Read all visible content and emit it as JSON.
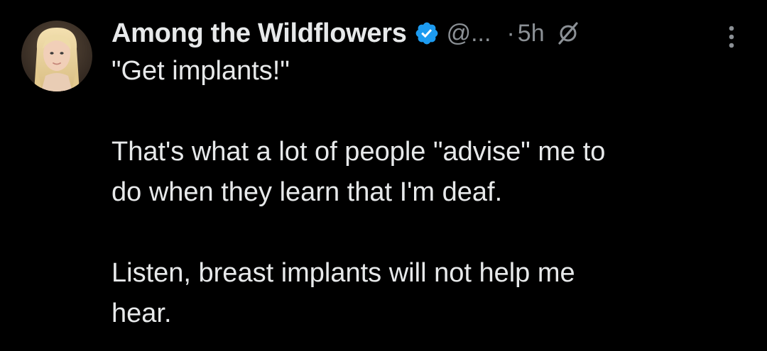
{
  "tweet": {
    "author": {
      "display_name": "Among the Wildflowers",
      "handle": "@...",
      "verified": true,
      "avatar_icon": "avatar-woman-blonde"
    },
    "dot_separator": "·",
    "time": "5h",
    "grok_icon": "grok-icon",
    "more_icon": "more-vertical-icon",
    "text": {
      "line1": "\"Get implants!\"",
      "line2a": "That's what a lot of people \"advise\" me to",
      "line2b": "do when they learn that I'm deaf.",
      "line3a": "Listen, breast implants will not help me",
      "line3b": "hear."
    },
    "colors": {
      "background": "#000000",
      "text": "#e7e9ea",
      "secondary": "#8b9095",
      "verified": "#1d9bf0"
    }
  }
}
